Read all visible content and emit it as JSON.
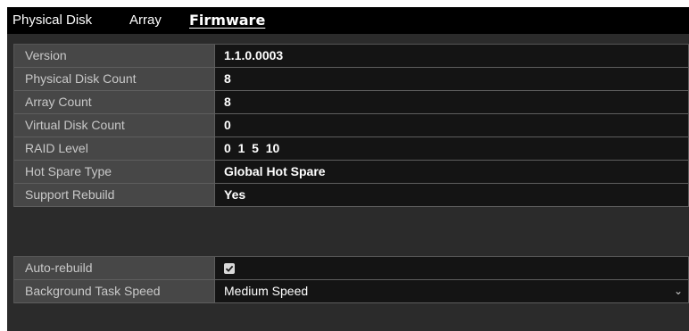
{
  "tabs": {
    "physical_disk": "Physical Disk",
    "array": "Array",
    "firmware": "Firmware"
  },
  "info_rows": [
    {
      "label": "Version",
      "value": "1.1.0.0003"
    },
    {
      "label": "Physical Disk Count",
      "value": "8"
    },
    {
      "label": "Array Count",
      "value": "8"
    },
    {
      "label": "Virtual Disk Count",
      "value": "0"
    },
    {
      "label": "RAID Level",
      "value": "0  1  5  10"
    },
    {
      "label": "Hot Spare Type",
      "value": "Global Hot Spare"
    },
    {
      "label": "Support Rebuild",
      "value": "Yes"
    }
  ],
  "settings": {
    "auto_rebuild_label": "Auto-rebuild",
    "auto_rebuild_checked": true,
    "background_speed_label": "Background Task Speed",
    "background_speed_value": "Medium Speed"
  },
  "icons": {
    "checkbox": "checkmark-icon",
    "dropdown": "chevron-down-icon"
  }
}
